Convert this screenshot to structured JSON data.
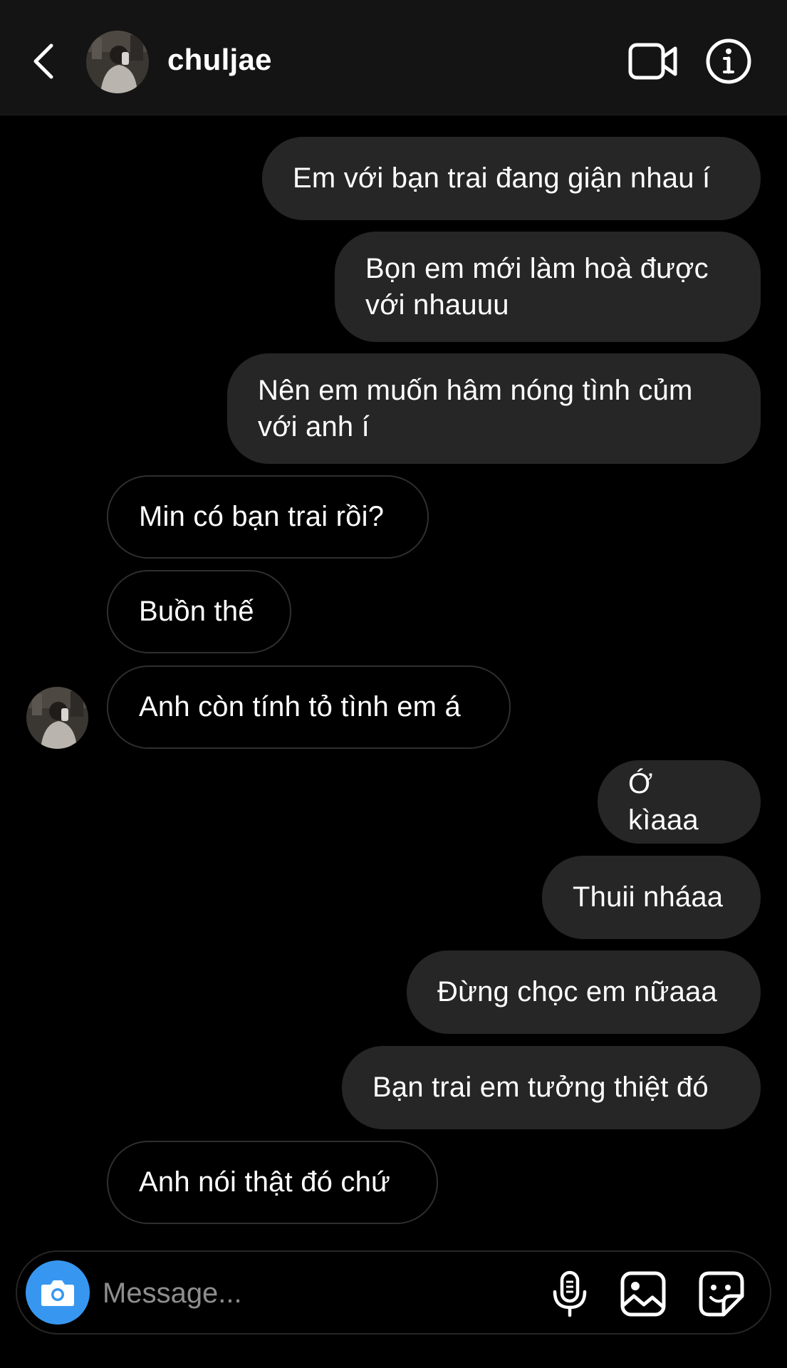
{
  "header": {
    "username": "chuljae"
  },
  "messages": [
    {
      "side": "sent",
      "text": "Em với bạn trai đang giận nhau í"
    },
    {
      "side": "sent",
      "text": "Bọn em mới làm hoà được với nhauuu"
    },
    {
      "side": "sent",
      "text": "Nên em muốn hâm nóng tình củm với anh í"
    },
    {
      "side": "received",
      "text": "Min có bạn trai rồi?"
    },
    {
      "side": "received",
      "text": "Buồn thế"
    },
    {
      "side": "received",
      "text": "Anh còn tính tỏ tình em á"
    },
    {
      "side": "sent",
      "text": "Ớ kìaaa"
    },
    {
      "side": "sent",
      "text": "Thuii nháaa"
    },
    {
      "side": "sent",
      "text": "Đừng chọc em nữaaa"
    },
    {
      "side": "sent",
      "text": "Bạn trai em tưởng thiệt đó"
    },
    {
      "side": "received",
      "text": "Anh nói thật đó chứ"
    }
  ],
  "composer": {
    "placeholder": "Message..."
  },
  "colors": {
    "background": "#000000",
    "header_bg": "#141414",
    "sent_bubble": "#262626",
    "received_border": "#2f2f2f",
    "camera_button": "#3797f0",
    "placeholder": "#8e8e8e"
  },
  "icons": {
    "back": "chevron-left-icon",
    "video": "video-camera-icon",
    "info": "info-icon",
    "camera": "camera-icon",
    "mic": "microphone-icon",
    "gallery": "image-icon",
    "sticker": "sticker-icon"
  }
}
